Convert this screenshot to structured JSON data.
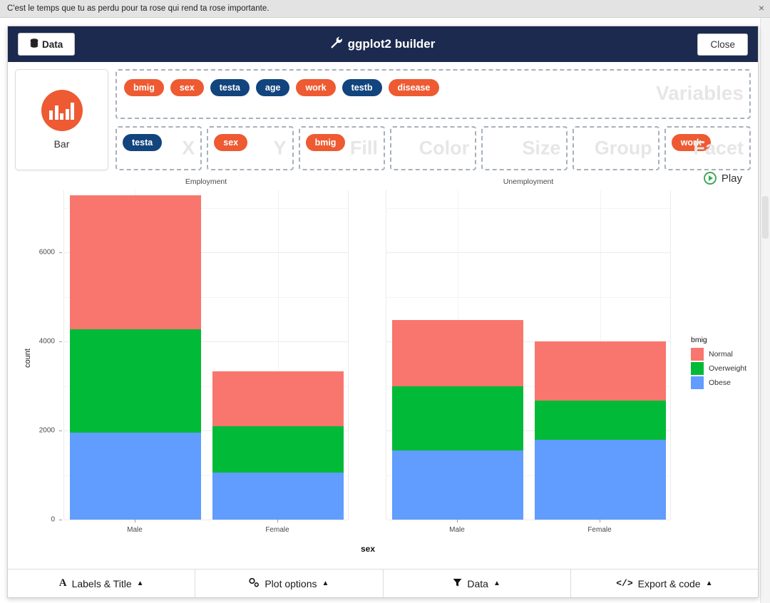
{
  "notification": {
    "text": "C'est le temps que tu as perdu pour ta rose qui rend ta rose importante.",
    "close_label": "×"
  },
  "header": {
    "data_button": "Data",
    "data_icon": "database-icon",
    "title": "ggplot2 builder",
    "title_icon": "wrench-icon",
    "close_button": "Close"
  },
  "geom": {
    "label": "Bar",
    "icon": "bar-chart-icon"
  },
  "variables": {
    "ghost_label": "Variables",
    "items": [
      {
        "name": "bmig",
        "color": "orange"
      },
      {
        "name": "sex",
        "color": "orange"
      },
      {
        "name": "testa",
        "color": "blue"
      },
      {
        "name": "age",
        "color": "blue"
      },
      {
        "name": "work",
        "color": "orange"
      },
      {
        "name": "testb",
        "color": "blue"
      },
      {
        "name": "disease",
        "color": "orange"
      }
    ]
  },
  "zones": [
    {
      "ghost_label": "X",
      "pill": "testa",
      "pill_color": "blue"
    },
    {
      "ghost_label": "Y",
      "pill": "sex",
      "pill_color": "orange"
    },
    {
      "ghost_label": "Fill",
      "pill": "bmig",
      "pill_color": "orange"
    },
    {
      "ghost_label": "Color",
      "pill": null,
      "pill_color": null
    },
    {
      "ghost_label": "Size",
      "pill": null,
      "pill_color": null
    },
    {
      "ghost_label": "Group",
      "pill": null,
      "pill_color": null
    },
    {
      "ghost_label": "Facet",
      "pill": "work",
      "pill_color": "orange"
    }
  ],
  "play": {
    "label": "Play",
    "icon": "play-circle-icon"
  },
  "bottom_bar": [
    {
      "label": "Labels & Title",
      "icon": "font-icon",
      "caret": "▲"
    },
    {
      "label": "Plot options",
      "icon": "sliders-icon",
      "caret": "▲"
    },
    {
      "label": "Data",
      "icon": "filter-icon",
      "caret": "▲"
    },
    {
      "label": "Export & code",
      "icon": "code-icon",
      "caret": "▲"
    }
  ],
  "chart_data": {
    "type": "bar",
    "stacked": true,
    "title": "",
    "xlabel": "sex",
    "ylabel": "count",
    "ylim": [
      0,
      7400
    ],
    "yticks": [
      0,
      2000,
      4000,
      6000
    ],
    "ytick_labels": [
      "0",
      "2000",
      "4000",
      "6000"
    ],
    "yminor": [
      1000,
      3000,
      5000,
      7000
    ],
    "grid": true,
    "legend": {
      "title": "bmig",
      "position": "right",
      "entries": [
        {
          "label": "Normal",
          "color": "#F8766D"
        },
        {
          "label": "Overweight",
          "color": "#00BA38"
        },
        {
          "label": "Obese",
          "color": "#619CFF"
        }
      ]
    },
    "facet_variable": "work",
    "facets": [
      {
        "label": "Employment",
        "categories": [
          "Male",
          "Female"
        ],
        "series": [
          {
            "name": "Obese",
            "color": "#619CFF",
            "values": [
              1960,
              1060
            ]
          },
          {
            "name": "Overweight",
            "color": "#00BA38",
            "values": [
              2320,
              1040
            ]
          },
          {
            "name": "Normal",
            "color": "#F8766D",
            "values": [
              3010,
              1240
            ]
          }
        ],
        "totals": [
          7290,
          3340
        ]
      },
      {
        "label": "Unemployment",
        "categories": [
          "Male",
          "Female"
        ],
        "series": [
          {
            "name": "Obese",
            "color": "#619CFF",
            "values": [
              1560,
              1800
            ]
          },
          {
            "name": "Overweight",
            "color": "#00BA38",
            "values": [
              1430,
              870
            ]
          },
          {
            "name": "Normal",
            "color": "#F8766D",
            "values": [
              1490,
              1340
            ]
          }
        ],
        "totals": [
          4480,
          4010
        ]
      }
    ]
  }
}
